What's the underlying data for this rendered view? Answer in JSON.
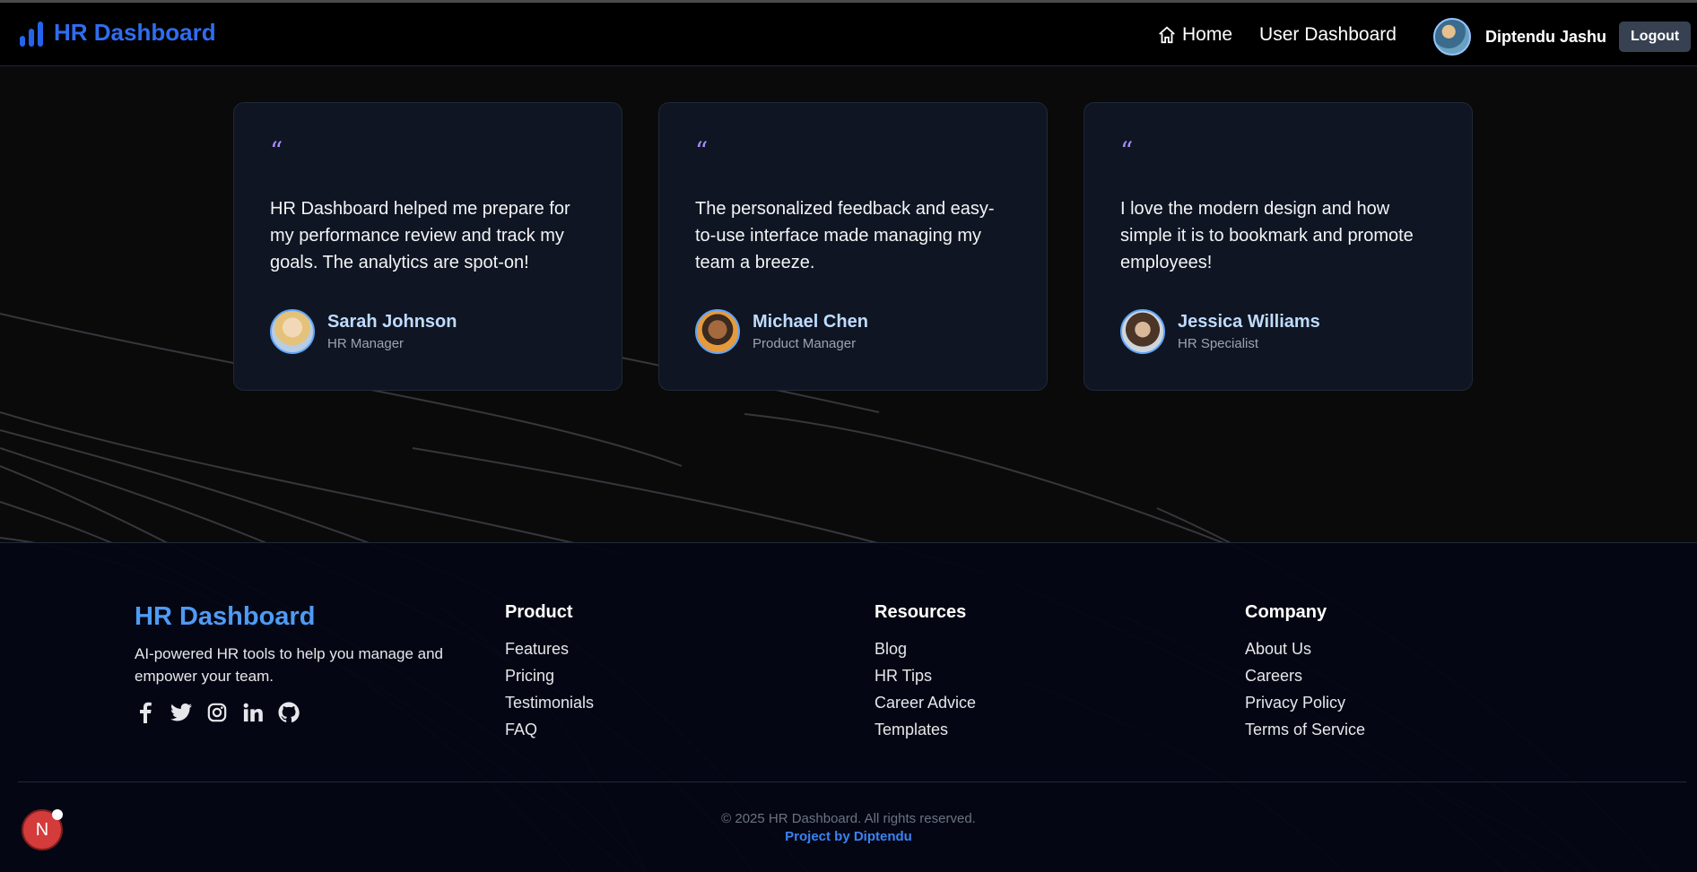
{
  "nav": {
    "brand": "HR Dashboard",
    "links": [
      {
        "label": "Home",
        "icon": "home-icon"
      },
      {
        "label": "User Dashboard"
      }
    ],
    "user_name": "Diptendu Jashu",
    "logout_label": "Logout"
  },
  "testimonials": [
    {
      "quote_mark": "“",
      "text": "HR Dashboard helped me prepare for my performance review and track my goals. The analytics are spot-on!",
      "name": "Sarah Johnson",
      "role": "HR Manager"
    },
    {
      "quote_mark": "“",
      "text": "The personalized feedback and easy-to-use interface made managing my team a breeze.",
      "name": "Michael Chen",
      "role": "Product Manager"
    },
    {
      "quote_mark": "“",
      "text": "I love the modern design and how simple it is to bookmark and promote employees!",
      "name": "Jessica Williams",
      "role": "HR Specialist"
    }
  ],
  "footer": {
    "brand": "HR Dashboard",
    "tagline": "AI-powered HR tools to help you manage and empower your team.",
    "socials": [
      "facebook-icon",
      "twitter-icon",
      "instagram-icon",
      "linkedin-icon",
      "github-icon"
    ],
    "columns": [
      {
        "title": "Product",
        "links": [
          "Features",
          "Pricing",
          "Testimonials",
          "FAQ"
        ]
      },
      {
        "title": "Resources",
        "links": [
          "Blog",
          "HR Tips",
          "Career Advice",
          "Templates"
        ]
      },
      {
        "title": "Company",
        "links": [
          "About Us",
          "Careers",
          "Privacy Policy",
          "Terms of Service"
        ]
      }
    ],
    "copyright": "© 2025 HR Dashboard. All rights reserved.",
    "credit": "Project by Diptendu"
  },
  "badge": {
    "letter": "N"
  },
  "colors": {
    "brand": "#2f6df0",
    "accent_quote": "#a78bfa",
    "card_bg": "#0f1522",
    "footer_bg": "#040714"
  }
}
